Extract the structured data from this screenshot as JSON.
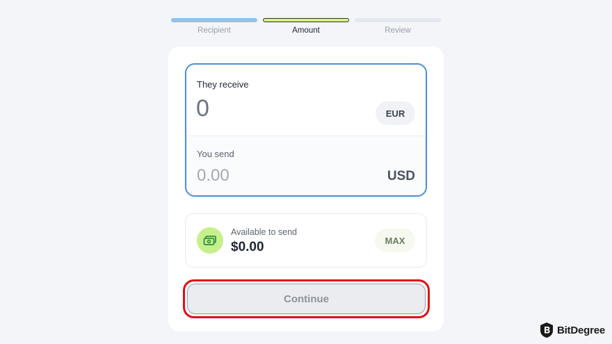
{
  "stepper": {
    "steps": [
      {
        "label": "Recipient",
        "state": "completed"
      },
      {
        "label": "Amount",
        "state": "active"
      },
      {
        "label": "Review",
        "state": "pending"
      }
    ]
  },
  "receive": {
    "title": "They receive",
    "amount": "0",
    "currency": "EUR"
  },
  "send": {
    "title": "You send",
    "amount_placeholder": "0.00",
    "currency": "USD"
  },
  "balance": {
    "label": "Available to send",
    "value": "$0.00",
    "max_label": "MAX",
    "icon": "cash-icon"
  },
  "actions": {
    "continue_label": "Continue"
  },
  "watermark": {
    "brand": "BitDegree"
  },
  "colors": {
    "accent_blue": "#4a90d6",
    "accent_green": "#c6f08b",
    "highlight_red": "#e30c17"
  }
}
